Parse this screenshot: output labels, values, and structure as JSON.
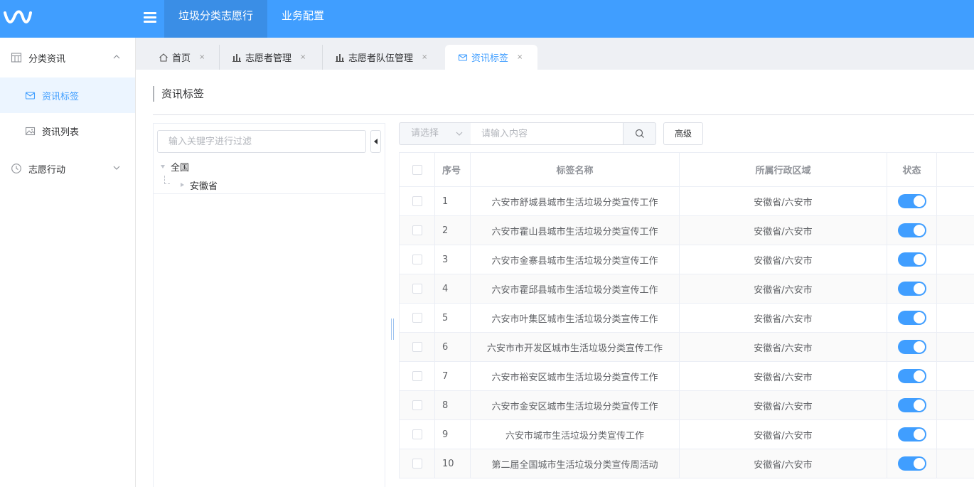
{
  "topbar": {
    "nav": [
      "垃圾分类志愿行",
      "业务配置"
    ],
    "active_index": 0
  },
  "sidebar": {
    "groups": [
      {
        "label": "分类资讯",
        "icon": "table-icon",
        "expanded": true,
        "items": [
          {
            "label": "资讯标签",
            "icon": "tag-card-icon",
            "active": true
          },
          {
            "label": "资讯列表",
            "icon": "image-icon",
            "active": false
          }
        ]
      },
      {
        "label": "志愿行动",
        "icon": "clock-icon",
        "expanded": false,
        "items": []
      }
    ]
  },
  "tabs": [
    {
      "label": "首页",
      "icon": "home-icon",
      "close": "×",
      "active": false
    },
    {
      "label": "志愿者管理",
      "icon": "bar-chart-icon",
      "close": "×",
      "active": false
    },
    {
      "label": "志愿者队伍管理",
      "icon": "bar-chart-icon",
      "close": "×",
      "active": false
    },
    {
      "label": "资讯标签",
      "icon": "tag-card-icon",
      "close": "×",
      "active": true
    }
  ],
  "page": {
    "title": "资讯标签"
  },
  "tree": {
    "filter_placeholder": "输入关键字进行过滤",
    "root": "全国",
    "child": "安徽省"
  },
  "search": {
    "select_placeholder": "请选择",
    "input_placeholder": "请输入内容",
    "advanced_label": "高级"
  },
  "table": {
    "headers": [
      "序号",
      "标签名称",
      "所属行政区域",
      "状态"
    ],
    "rows": [
      {
        "no": "1",
        "name": "六安市舒城县城市生活垃圾分类宣传工作",
        "region": "安徽省/六安市",
        "enabled": true
      },
      {
        "no": "2",
        "name": "六安市霍山县城市生活垃圾分类宣传工作",
        "region": "安徽省/六安市",
        "enabled": true
      },
      {
        "no": "3",
        "name": "六安市金寨县城市生活垃圾分类宣传工作",
        "region": "安徽省/六安市",
        "enabled": true
      },
      {
        "no": "4",
        "name": "六安市霍邱县城市生活垃圾分类宣传工作",
        "region": "安徽省/六安市",
        "enabled": true
      },
      {
        "no": "5",
        "name": "六安市叶集区城市生活垃圾分类宣传工作",
        "region": "安徽省/六安市",
        "enabled": true
      },
      {
        "no": "6",
        "name": "六安市市开发区城市生活垃圾分类宣传工作",
        "region": "安徽省/六安市",
        "enabled": true
      },
      {
        "no": "7",
        "name": "六安市裕安区城市生活垃圾分类宣传工作",
        "region": "安徽省/六安市",
        "enabled": true
      },
      {
        "no": "8",
        "name": "六安市金安区城市生活垃圾分类宣传工作",
        "region": "安徽省/六安市",
        "enabled": true
      },
      {
        "no": "9",
        "name": "六安市城市生活垃圾分类宣传工作",
        "region": "安徽省/六安市",
        "enabled": true
      },
      {
        "no": "10",
        "name": "第二届全国城市生活垃圾分类宣传周活动",
        "region": "安徽省/六安市",
        "enabled": true
      }
    ]
  },
  "colors": {
    "primary": "#409eff",
    "active_tab_bg": "#3a8ee6",
    "sidebar_active_bg": "#ecf5ff"
  }
}
